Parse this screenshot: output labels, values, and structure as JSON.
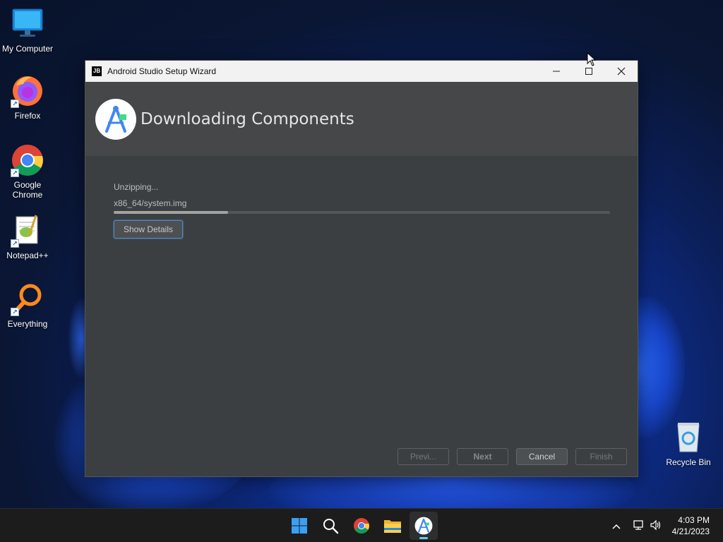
{
  "desktop": {
    "icons": [
      {
        "label": "My Computer",
        "icon": "monitor-icon"
      },
      {
        "label": "Firefox",
        "icon": "firefox-icon"
      },
      {
        "label": "Google Chrome",
        "icon": "chrome-icon"
      },
      {
        "label": "Notepad++",
        "icon": "notepad-plus-plus-icon"
      },
      {
        "label": "Everything",
        "icon": "everything-search-icon"
      },
      {
        "label": "Recycle Bin",
        "icon": "recycle-bin-icon"
      }
    ]
  },
  "window": {
    "app_badge": "JB",
    "title": "Android Studio Setup Wizard",
    "header_title": "Downloading Components",
    "status_text": "Unzipping...",
    "current_file": "x86_64/system.img",
    "progress_fraction": 0.23,
    "show_details_label": "Show Details",
    "buttons": {
      "prev": "Previ...",
      "next": "Next",
      "cancel": "Cancel",
      "finish": "Finish"
    }
  },
  "taskbar": {
    "apps": [
      "windows-start-icon",
      "search-icon",
      "chrome-icon",
      "file-explorer-icon",
      "android-studio-icon"
    ],
    "time": "4:03 PM",
    "date": "4/21/2023"
  },
  "colors": {
    "window_bg": "#3c3f41",
    "header_bg": "#454748",
    "accent_focus": "#5a84b8",
    "taskbar_bg": "#1c1c1c",
    "active_indicator": "#60cdff"
  }
}
